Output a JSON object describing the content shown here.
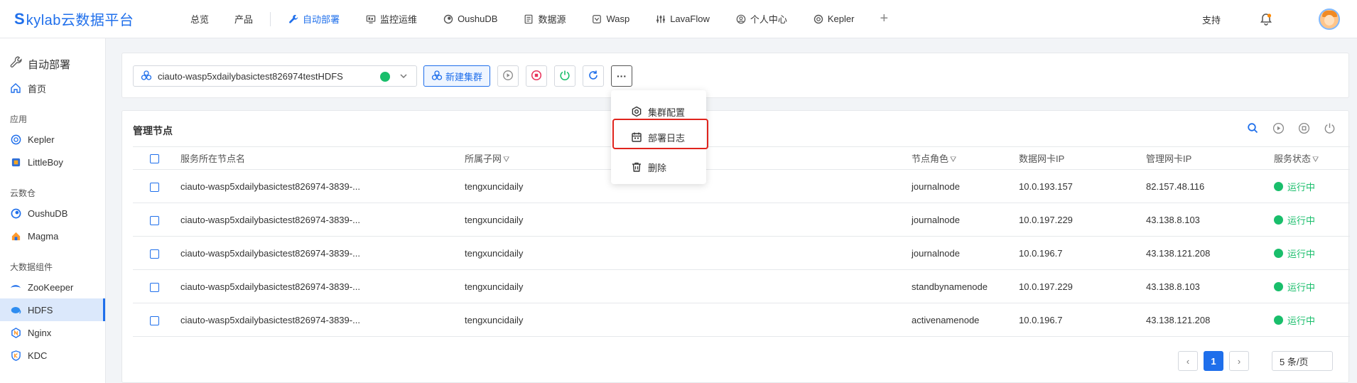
{
  "brand": {
    "logo": "S",
    "name": "kylab云数据平台"
  },
  "nav": [
    {
      "label": "总览",
      "icon": ""
    },
    {
      "label": "产品",
      "icon": ""
    },
    {
      "label": "自动部署",
      "icon": "wrench-icon",
      "active": true
    },
    {
      "label": "监控运维",
      "icon": "monitor-icon"
    },
    {
      "label": "OushuDB",
      "icon": "oushudb-icon"
    },
    {
      "label": "数据源",
      "icon": "document-icon"
    },
    {
      "label": "Wasp",
      "icon": "wasp-icon"
    },
    {
      "label": "LavaFlow",
      "icon": "lavaflow-icon"
    },
    {
      "label": "个人中心",
      "icon": "user-circle-icon"
    },
    {
      "label": "Kepler",
      "icon": "kepler-icon"
    }
  ],
  "top_right": {
    "support": "支持"
  },
  "sidebar": {
    "title": "自动部署",
    "home": "首页",
    "groups": [
      {
        "label": "应用",
        "items": [
          "Kepler",
          "LittleBoy"
        ]
      },
      {
        "label": "云数仓",
        "items": [
          "OushuDB",
          "Magma"
        ]
      },
      {
        "label": "大数据组件",
        "items": [
          "ZooKeeper",
          "HDFS",
          "Nginx",
          "KDC"
        ]
      }
    ],
    "active": "HDFS"
  },
  "toolbar": {
    "cluster_value": "ciauto-wasp5xdailybasictest826974testHDFS",
    "new_cluster": "新建集群",
    "more": "···"
  },
  "menu": {
    "items": [
      "集群配置",
      "部署日志",
      "删除"
    ],
    "highlighted": "部署日志"
  },
  "table": {
    "title": "管理节点",
    "headers": [
      "服务所在节点名",
      "所属子网",
      "节点角色",
      "数据网卡IP",
      "管理网卡IP",
      "服务状态"
    ],
    "rows": [
      {
        "name": "ciauto-wasp5xdailybasictest826974-3839-...",
        "subnet": "tengxuncidaily",
        "role": "journalnode",
        "data_ip": "10.0.193.157",
        "mgmt_ip": "82.157.48.116",
        "status": "运行中"
      },
      {
        "name": "ciauto-wasp5xdailybasictest826974-3839-...",
        "subnet": "tengxuncidaily",
        "role": "journalnode",
        "data_ip": "10.0.197.229",
        "mgmt_ip": "43.138.8.103",
        "status": "运行中"
      },
      {
        "name": "ciauto-wasp5xdailybasictest826974-3839-...",
        "subnet": "tengxuncidaily",
        "role": "journalnode",
        "data_ip": "10.0.196.7",
        "mgmt_ip": "43.138.121.208",
        "status": "运行中"
      },
      {
        "name": "ciauto-wasp5xdailybasictest826974-3839-...",
        "subnet": "tengxuncidaily",
        "role": "standbynamenode",
        "data_ip": "10.0.197.229",
        "mgmt_ip": "43.138.8.103",
        "status": "运行中"
      },
      {
        "name": "ciauto-wasp5xdailybasictest826974-3839-...",
        "subnet": "tengxuncidaily",
        "role": "activenamenode",
        "data_ip": "10.0.196.7",
        "mgmt_ip": "43.138.121.208",
        "status": "运行中"
      }
    ]
  },
  "pager": {
    "current": "1",
    "page_size": "5 条/页",
    "prev": "‹",
    "next": "›"
  },
  "colors": {
    "accent": "#1f6feb",
    "running": "#19be6b",
    "highlight": "#e0241d"
  }
}
